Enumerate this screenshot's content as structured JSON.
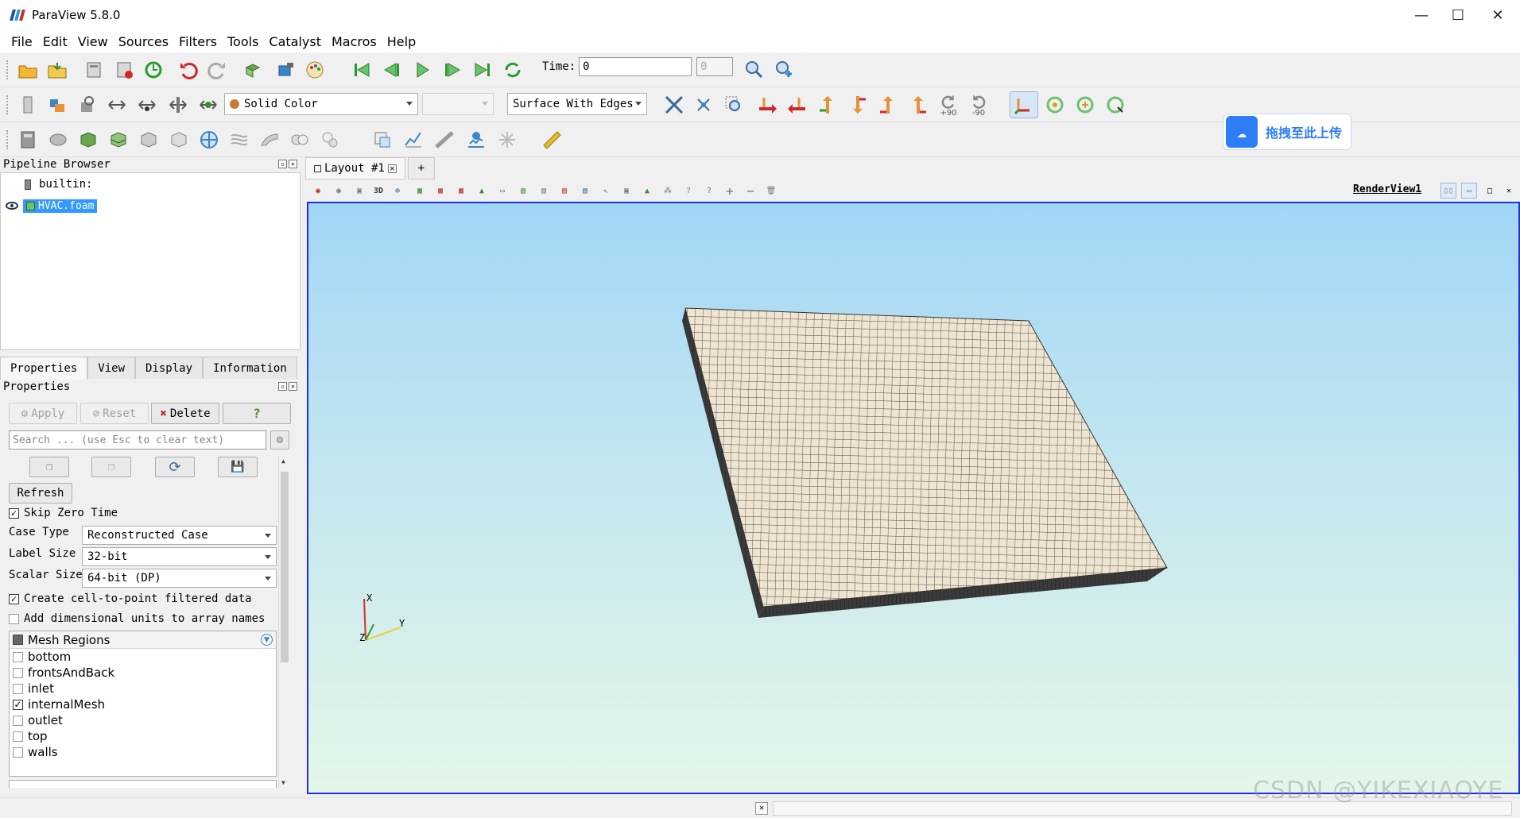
{
  "window": {
    "title": "ParaView 5.8.0",
    "minimize": "—",
    "maximize": "☐",
    "close": "✕"
  },
  "menu": [
    "File",
    "Edit",
    "View",
    "Sources",
    "Filters",
    "Tools",
    "Catalyst",
    "Macros",
    "Help"
  ],
  "time": {
    "label": "Time:",
    "value": "0",
    "index": "0"
  },
  "color_by": "Solid Color",
  "representation": "Surface With Edges",
  "camera_labels": {
    "plus90": "+90",
    "minus90": "-90"
  },
  "pipeline": {
    "title": "Pipeline Browser",
    "root": "builtin:",
    "source": "HVAC.foam"
  },
  "tabs": [
    "Properties",
    "View",
    "Display",
    "Information"
  ],
  "properties": {
    "title": "Properties",
    "apply": "Apply",
    "reset": "Reset",
    "delete": "Delete",
    "help": "?",
    "search_placeholder": "Search ... (use Esc to clear text)",
    "refresh": "Refresh",
    "skip_zero_time": "Skip Zero Time",
    "case_type_label": "Case Type",
    "case_type_value": "Reconstructed Case",
    "label_size_label": "Label Size",
    "label_size_value": "32-bit",
    "scalar_size_label": "Scalar Size",
    "scalar_size_value": "64-bit (DP)",
    "cell_to_point": "Create cell-to-point filtered data",
    "dimensional_units": "Add dimensional units to array names",
    "mesh_regions_title": "Mesh Regions",
    "mesh_regions": [
      {
        "name": "bottom",
        "checked": false
      },
      {
        "name": "frontsAndBack",
        "checked": false
      },
      {
        "name": "inlet",
        "checked": false
      },
      {
        "name": "internalMesh",
        "checked": true
      },
      {
        "name": "outlet",
        "checked": false
      },
      {
        "name": "top",
        "checked": false
      },
      {
        "name": "walls",
        "checked": false
      }
    ]
  },
  "layout": {
    "tab": "Layout #1",
    "add": "+",
    "view_name": "RenderView1",
    "view3d": "3D"
  },
  "axes": {
    "x": "X",
    "y": "Y",
    "z": "Z"
  },
  "overlay": {
    "baidu_upload": "拖拽至此上传",
    "watermark": "CSDN @YIKEXIAOYE"
  },
  "colors": {
    "accent": "#2030d8",
    "selection": "#3399ff",
    "mesh_face": "#efe4d0",
    "mesh_side": "#3a3a3a"
  }
}
